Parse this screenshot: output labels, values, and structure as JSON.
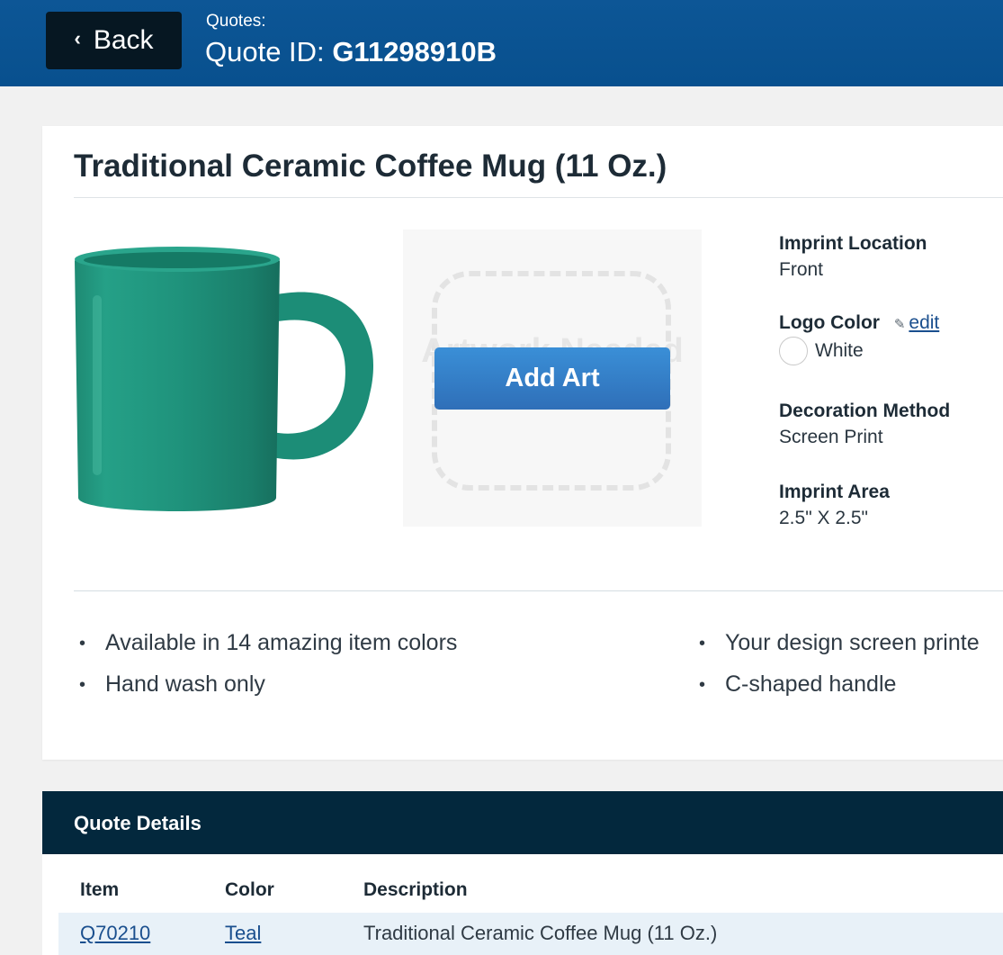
{
  "header": {
    "back_label": "Back",
    "breadcrumb": "Quotes:",
    "quote_id_prefix": "Quote ID:",
    "quote_id": "G11298910B"
  },
  "product": {
    "title": "Traditional Ceramic Coffee Mug (11 Oz.)",
    "image_alt": "Teal ceramic coffee mug",
    "mug_color": "#21907c",
    "art_placeholder": "Artwork Needed",
    "add_art_label": "Add Art",
    "specs": {
      "imprint_location_label": "Imprint Location",
      "imprint_location": "Front",
      "logo_color_label": "Logo Color",
      "edit_label": "edit",
      "logo_color": "White",
      "decoration_method_label": "Decoration Method",
      "decoration_method": "Screen Print",
      "imprint_area_label": "Imprint Area",
      "imprint_area": "2.5\" X 2.5\""
    },
    "features_left": [
      "Available in 14 amazing item colors",
      "Hand wash only"
    ],
    "features_right": [
      "Your design screen printe",
      "C-shaped handle"
    ]
  },
  "quote_details": {
    "title": "Quote Details",
    "columns": [
      "Item",
      "Color",
      "Description"
    ],
    "rows": [
      {
        "item": "Q70210",
        "color": "Teal",
        "description": "Traditional Ceramic Coffee Mug (11 Oz.)"
      }
    ]
  },
  "colors": {
    "header_blue": "#0b5393",
    "back_button": "#061722",
    "accent_button": "#3383cc",
    "details_header": "#03283d",
    "row_highlight": "#e8f1f8"
  }
}
